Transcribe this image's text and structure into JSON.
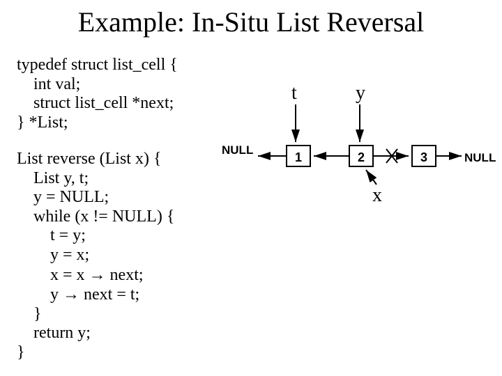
{
  "title": "Example: In-Situ List Reversal",
  "typedef": {
    "l1": "typedef struct list_cell {",
    "l2": "    int val;",
    "l3": "    struct list_cell *next;",
    "l4": "} *List;"
  },
  "func": {
    "l1": "List reverse (List x) {",
    "l2": "    List y, t;",
    "l3": "    y = NULL;",
    "l4": "    while (x != NULL) {",
    "l5": "        t = y;",
    "l6": "        y = x;",
    "l7a": "        x = x ",
    "l7b": " next;",
    "l8a": "        y ",
    "l8b": " next = t;",
    "l9": "    }",
    "l10": "    return y;",
    "l11": "}"
  },
  "arrow": "→",
  "diagram": {
    "t": "t",
    "y": "y",
    "x": "x",
    "null": "NULL",
    "n1": "1",
    "n2": "2",
    "n3": "3"
  }
}
